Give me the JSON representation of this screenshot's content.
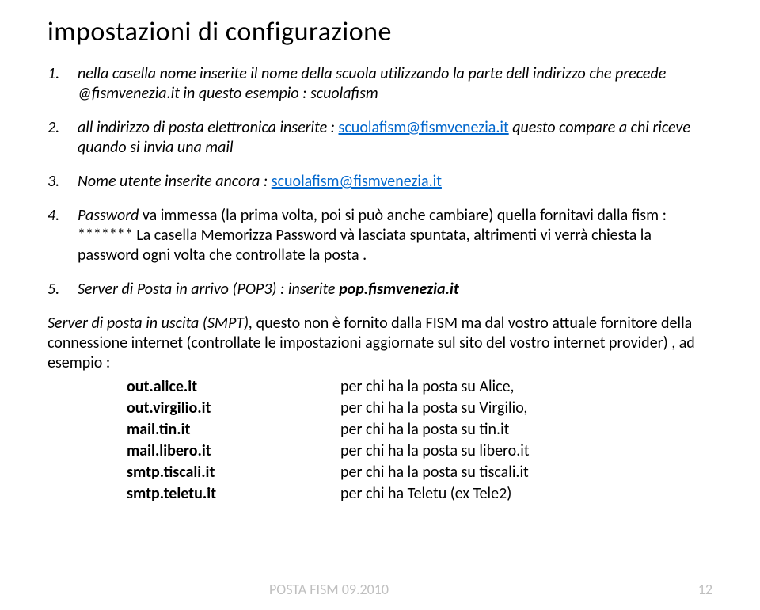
{
  "title": "impostazioni di configurazione",
  "items": {
    "1": {
      "pre": "nella casella nome inserite il nome della scuola utilizzando la parte dell indirizzo che precede @fismvenezia.it in questo esempio : scuolafism"
    },
    "2": {
      "pre": "all indirizzo di posta elettronica inserite : ",
      "link": "scuolafism@fismvenezia.it",
      "post": " questo compare a chi riceve quando si invia una mail"
    },
    "3": {
      "pre": "Nome utente inserite ancora : ",
      "link": "scuolafism@fismvenezia.it"
    },
    "4": {
      "lead": "Password",
      "rest": " va immessa (la prima volta, poi si può anche cambiare) quella fornitavi dalla fism : ******* La casella Memorizza Password và lasciata spuntata, altrimenti vi verrà chiesta la password ogni volta che controllate la posta ."
    },
    "5": {
      "lead": "Server di Posta in arrivo (POP3) ",
      "mid": ": inserite ",
      "bold": "pop.fismvenezia.it"
    }
  },
  "afterList": {
    "lead": "Server di posta in uscita (SMPT), ",
    "rest": "questo non è fornito dalla FISM ma dal vostro attuale fornitore della connessione internet (controllate le impostazioni aggiornate sul sito del vostro internet provider) , ad esempio :"
  },
  "servers": [
    {
      "host": "out.alice.it",
      "desc": "per chi ha la posta su Alice,"
    },
    {
      "host": "out.virgilio.it",
      "desc": "per chi ha la posta su Virgilio,"
    },
    {
      "host": "mail.tin.it",
      "desc": "per chi ha la posta su tin.it"
    },
    {
      "host": "mail.libero.it",
      "desc": "per chi ha la posta su libero.it"
    },
    {
      "host": "smtp.tiscali.it",
      "desc": "per chi ha la posta su tiscali.it"
    },
    {
      "host": "smtp.teletu.it",
      "desc": "per chi ha Teletu (ex Tele2)"
    }
  ],
  "footer": {
    "left": "POSTA FISM 09.2010",
    "right": "12"
  }
}
